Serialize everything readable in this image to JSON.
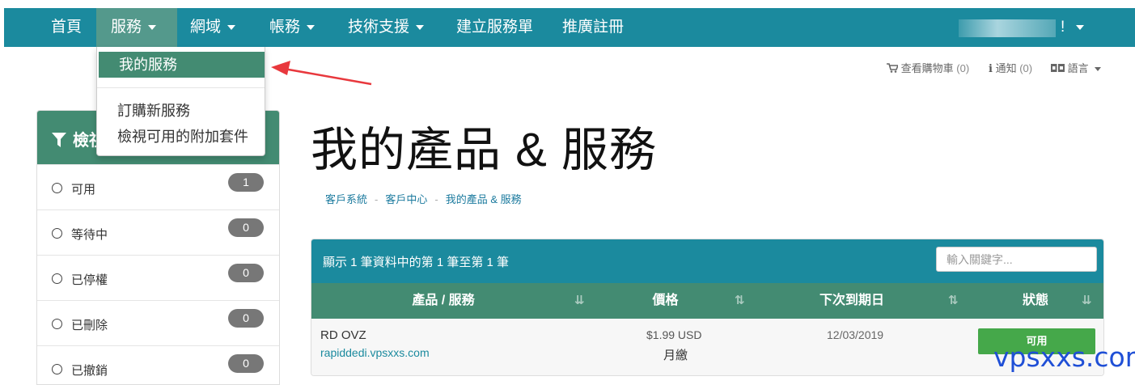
{
  "nav": {
    "items": [
      {
        "label": "首頁"
      },
      {
        "label": "服務"
      },
      {
        "label": "網域"
      },
      {
        "label": "帳務"
      },
      {
        "label": "技術支援"
      },
      {
        "label": "建立服務單"
      },
      {
        "label": "推廣註冊"
      }
    ],
    "user_suffix": "!"
  },
  "dropdown": {
    "items": [
      {
        "label": "我的服務"
      },
      {
        "label": "訂購新服務"
      },
      {
        "label": "檢視可用的附加套件"
      }
    ]
  },
  "utility": {
    "cart_label": "查看購物車",
    "cart_count": "(0)",
    "notify_label": "通知",
    "notify_count": "(0)",
    "language_label": "語言"
  },
  "filter_panel": {
    "title": "檢視",
    "items": [
      {
        "label": "可用",
        "count": "1"
      },
      {
        "label": "等待中",
        "count": "0"
      },
      {
        "label": "已停權",
        "count": "0"
      },
      {
        "label": "已刪除",
        "count": "0"
      },
      {
        "label": "已撤銷",
        "count": "0"
      }
    ]
  },
  "page": {
    "title": "我的產品 & 服務",
    "breadcrumb": [
      "客戶系統",
      "客戶中心",
      "我的產品 & 服務"
    ]
  },
  "table": {
    "info": "顯示 1 筆資料中的第 1 筆至第 1 筆",
    "search_placeholder": "輸入關鍵字...",
    "headers": [
      "產品 / 服務",
      "價格",
      "下次到期日",
      "狀態"
    ],
    "rows": [
      {
        "product": "RD OVZ",
        "domain": "rapiddedi.vpsxxs.com",
        "price": "$1.99 USD",
        "cycle": "月繳",
        "due": "12/03/2019",
        "status": "可用"
      }
    ]
  },
  "watermark": "vpsxxs.com",
  "colors": {
    "topbar": "#1b8a9e",
    "accent_green": "#438b72",
    "status_green": "#45a84a",
    "annotation_arrow": "#e8383d",
    "watermark": "#1f4fd6"
  }
}
